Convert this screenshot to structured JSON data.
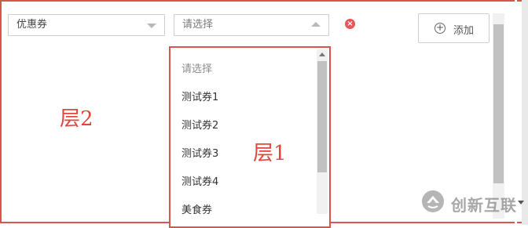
{
  "coupon_type_select": {
    "value": "优惠券"
  },
  "coupon_select": {
    "placeholder": "请选择"
  },
  "add_button": {
    "label": "添加"
  },
  "dropdown": {
    "options": [
      "请选择",
      "测试券1",
      "测试券2",
      "测试券3",
      "测试券4",
      "美食券"
    ]
  },
  "annotations": {
    "outer_layer": "层2",
    "inner_layer": "层1"
  },
  "watermark": {
    "text": "创新互联"
  },
  "colors": {
    "annotation_red": "#d9534f",
    "remove_red": "#e8555a"
  },
  "icons": [
    "chevron-down-icon",
    "chevron-up-icon",
    "remove-icon",
    "plus-circle-icon",
    "scroll-down-icon"
  ]
}
